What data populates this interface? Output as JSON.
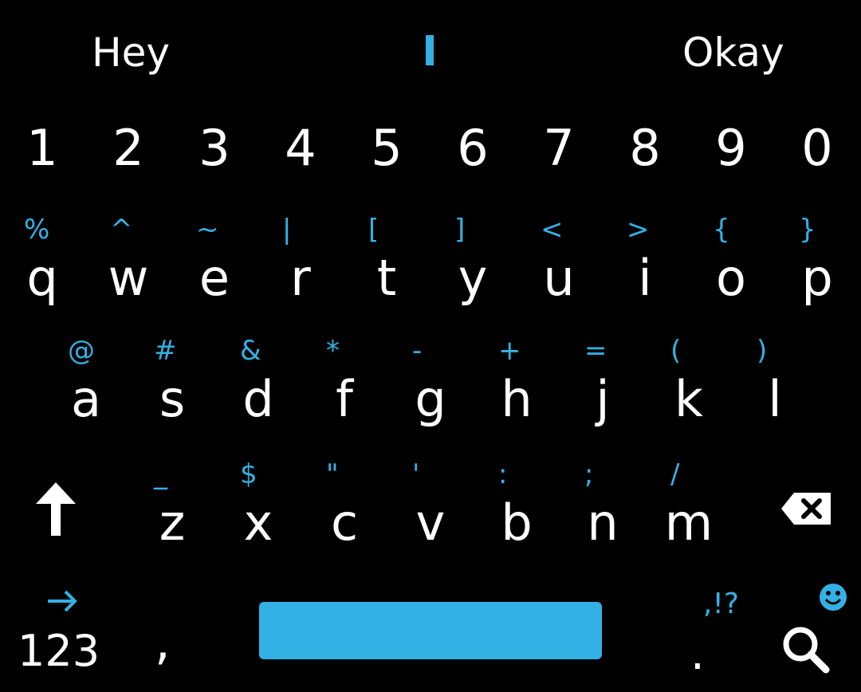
{
  "suggestions": {
    "left": "Hey",
    "right": "Okay"
  },
  "colors": {
    "accent": "#33b1e4",
    "background": "#000000",
    "text": "#ffffff"
  },
  "number_row": [
    "1",
    "2",
    "3",
    "4",
    "5",
    "6",
    "7",
    "8",
    "9",
    "0"
  ],
  "row_q": [
    {
      "sym": "%",
      "ch": "q"
    },
    {
      "sym": "^",
      "ch": "w"
    },
    {
      "sym": "~",
      "ch": "e"
    },
    {
      "sym": "|",
      "ch": "r"
    },
    {
      "sym": "[",
      "ch": "t"
    },
    {
      "sym": "]",
      "ch": "y"
    },
    {
      "sym": "<",
      "ch": "u"
    },
    {
      "sym": ">",
      "ch": "i"
    },
    {
      "sym": "{",
      "ch": "o"
    },
    {
      "sym": "}",
      "ch": "p"
    }
  ],
  "row_a": [
    {
      "sym": "@",
      "ch": "a"
    },
    {
      "sym": "#",
      "ch": "s"
    },
    {
      "sym": "&",
      "ch": "d"
    },
    {
      "sym": "*",
      "ch": "f"
    },
    {
      "sym": "-",
      "ch": "g"
    },
    {
      "sym": "+",
      "ch": "h"
    },
    {
      "sym": "=",
      "ch": "j"
    },
    {
      "sym": "(",
      "ch": "k"
    },
    {
      "sym": ")",
      "ch": "l"
    }
  ],
  "row_z": [
    {
      "sym": "_",
      "ch": "z"
    },
    {
      "sym": "$",
      "ch": "x"
    },
    {
      "sym": "\"",
      "ch": "c"
    },
    {
      "sym": "'",
      "ch": "v"
    },
    {
      "sym": ":",
      "ch": "b"
    },
    {
      "sym": ";",
      "ch": "n"
    },
    {
      "sym": "/",
      "ch": "m"
    }
  ],
  "bottom": {
    "numbers_label": "123",
    "comma": ",",
    "period": ".",
    "punct_hint": ",!?"
  },
  "icons": {
    "shift": "shift-arrow-icon",
    "backspace": "backspace-icon",
    "tab": "right-arrow-icon",
    "emoji": "smiley-icon",
    "search": "search-icon"
  }
}
